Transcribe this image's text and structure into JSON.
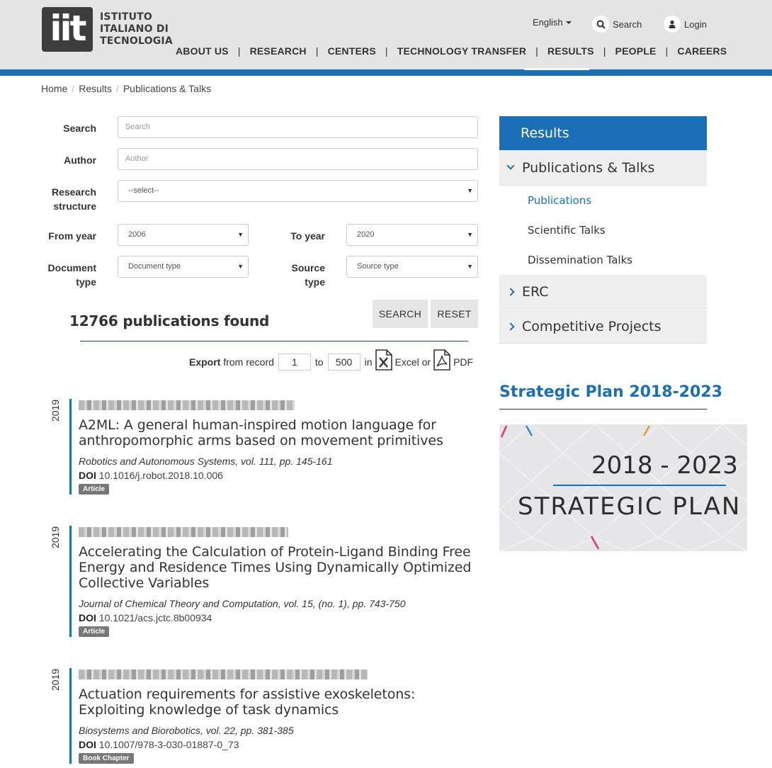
{
  "brand": {
    "logo_text": "iit",
    "name_lines": [
      "ISTITUTO",
      "ITALIANO DI",
      "TECNOLOGIA"
    ]
  },
  "util": {
    "language": "English",
    "search": "Search",
    "login": "Login"
  },
  "nav": [
    "ABOUT US",
    "RESEARCH",
    "CENTERS",
    "TECHNOLOGY TRANSFER",
    "RESULTS",
    "PEOPLE",
    "CAREERS"
  ],
  "nav_separator": "|",
  "breadcrumb": [
    "Home",
    "Results",
    "Publications & Talks"
  ],
  "breadcrumb_separator": "/",
  "form": {
    "search_label": "Search",
    "search_placeholder": "Search",
    "author_label": "Author",
    "author_placeholder": "Author",
    "research_structure_label_1": "Research",
    "research_structure_label_2": "structure",
    "research_structure_value": "--select--",
    "from_year_label": "From year",
    "from_year_value": "2006",
    "to_year_label": "To year",
    "to_year_value": "2020",
    "document_type_label_1": "Document",
    "document_type_label_2": "type",
    "document_type_value": "Document type",
    "source_type_label_1": "Source",
    "source_type_label_2": "type",
    "source_type_value": "Source type",
    "search_button": "SEARCH",
    "reset_button": "RESET",
    "select_arrow": "▼"
  },
  "results": {
    "found_text": "12766 publications found",
    "export": {
      "label": "Export",
      "from_text": "from record",
      "from_value": "1",
      "to_text": "to",
      "to_value": "500",
      "in_text": "in",
      "excel_text": "Excel or",
      "pdf_text": "PDF"
    },
    "publications": [
      {
        "year": "2019",
        "title": "A2ML: A general human-inspired motion language for anthropomorphic arms based on movement primitives",
        "source": "Robotics and Autonomous Systems, vol. 111, pp. 145-161",
        "doi_label": "DOI",
        "doi": "10.1016/j.robot.2018.10.006",
        "type": "Article"
      },
      {
        "year": "2019",
        "title": "Accelerating the Calculation of Protein-Ligand Binding Free Energy and Residence Times Using Dynamically Optimized Collective Variables",
        "source": "Journal of Chemical Theory and Computation, vol. 15, (no. 1), pp. 743-750",
        "doi_label": "DOI",
        "doi": "10.1021/acs.jctc.8b00934",
        "type": "Article"
      },
      {
        "year": "2019",
        "title": "Actuation requirements for assistive exoskeletons: Exploiting knowledge of task dynamics",
        "source": "Biosystems and Biorobotics, vol. 22, pp. 381-385",
        "doi_label": "DOI",
        "doi": "10.1007/978-3-030-01887-0_73",
        "type": "Book Chapter"
      }
    ]
  },
  "sidebar": {
    "header": "Results",
    "section_open": "Publications & Talks",
    "sub_items": [
      "Publications",
      "Scientific Talks",
      "Dissemination Talks"
    ],
    "section_erc": "ERC",
    "section_projects": "Competitive Projects",
    "strategic_title": "Strategic Plan 2018-2023",
    "banner_years": "2018 - 2023",
    "banner_words": "STRATEGIC PLAN"
  },
  "colors": {
    "accent": "#1a6fb6",
    "header_bg": "#e4e4e4",
    "sidebar_section_bg": "#efefef"
  },
  "icons": [
    "search-icon",
    "user-icon",
    "excel-file-icon",
    "pdf-file-icon",
    "chevron-down-icon",
    "chevron-right-icon",
    "caret-down-icon"
  ]
}
